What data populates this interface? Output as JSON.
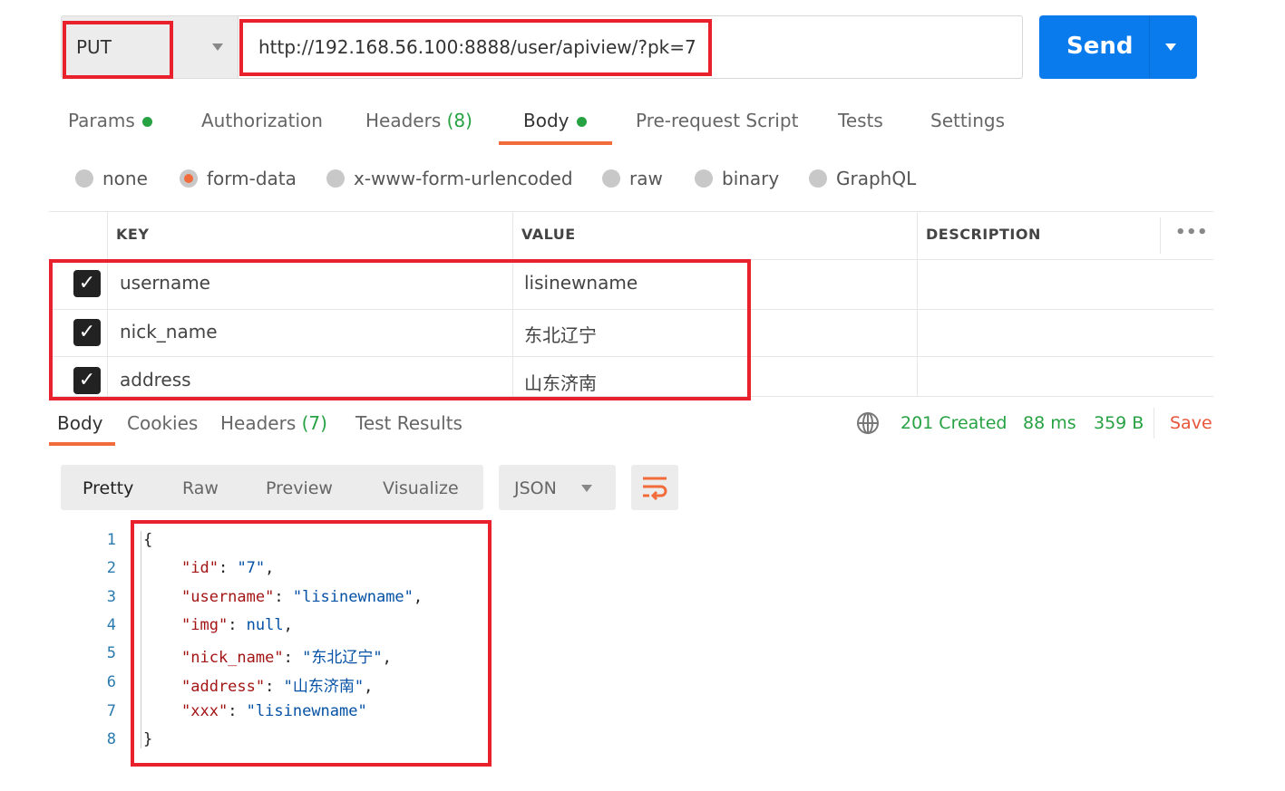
{
  "request": {
    "method": "PUT",
    "url": "http://192.168.56.100:8888/user/apiview/?pk=7",
    "send_label": "Send"
  },
  "tabs": [
    {
      "label": "Params",
      "dot": true
    },
    {
      "label": "Authorization"
    },
    {
      "label": "Headers ",
      "count": "(8)"
    },
    {
      "label": "Body",
      "dot": true,
      "active": true
    },
    {
      "label": "Pre-request Script"
    },
    {
      "label": "Tests"
    },
    {
      "label": "Settings"
    }
  ],
  "body_types": [
    "none",
    "form-data",
    "x-www-form-urlencoded",
    "raw",
    "binary",
    "GraphQL"
  ],
  "body_type_selected": "form-data",
  "table": {
    "headers": [
      "KEY",
      "VALUE",
      "DESCRIPTION"
    ],
    "more": "•••",
    "rows": [
      {
        "key": "username",
        "value": "lisinewname",
        "checked": true
      },
      {
        "key": "nick_name",
        "value": "东北辽宁",
        "checked": true
      },
      {
        "key": "address",
        "value": "山东济南",
        "checked": true
      }
    ]
  },
  "response": {
    "tabs": [
      "Body",
      "Cookies",
      "Headers ",
      "Test Results"
    ],
    "headers_count": "(7)",
    "status": "201 Created",
    "time": "88 ms",
    "size": "359 B",
    "save": "Save",
    "view_modes": [
      "Pretty",
      "Raw",
      "Preview",
      "Visualize"
    ],
    "format": "JSON",
    "line_numbers": [
      "1",
      "2",
      "3",
      "4",
      "5",
      "6",
      "7",
      "8"
    ],
    "code": {
      "open": "{",
      "close": "}",
      "lines": [
        {
          "k": "\"id\"",
          "v": "\"7\"",
          "end": ","
        },
        {
          "k": "\"username\"",
          "v": "\"lisinewname\"",
          "end": ","
        },
        {
          "k": "\"img\"",
          "v": "null",
          "end": ","
        },
        {
          "k": "\"nick_name\"",
          "v": "\"东北辽宁\"",
          "end": ","
        },
        {
          "k": "\"address\"",
          "v": "\"山东济南\"",
          "end": ","
        },
        {
          "k": "\"xxx\"",
          "v": "\"lisinewname\"",
          "end": ""
        }
      ]
    }
  },
  "colors": {
    "accent": "#f26b3a",
    "send": "#097bed",
    "success": "#27a243",
    "highlight": "#e8212c"
  }
}
